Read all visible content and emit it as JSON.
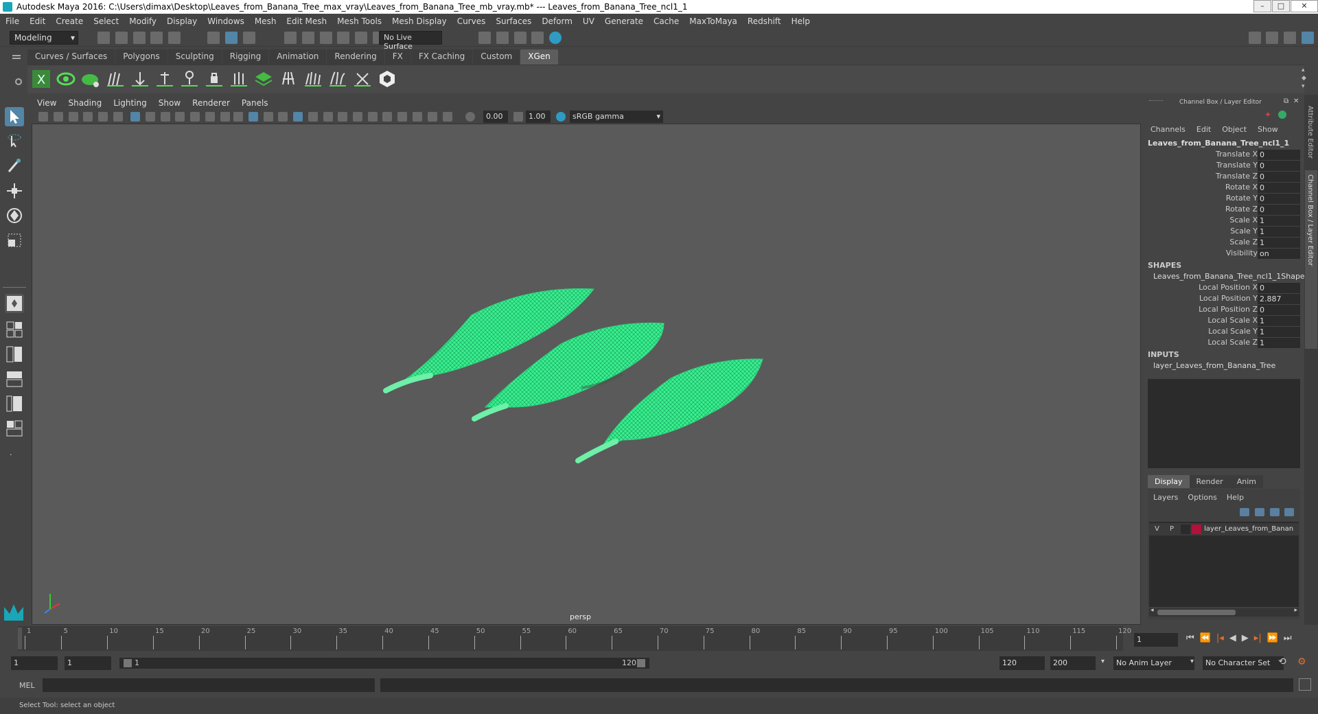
{
  "window": {
    "title": "Autodesk Maya 2016: C:\\Users\\dimax\\Desktop\\Leaves_from_Banana_Tree_max_vray\\Leaves_from_Banana_Tree_mb_vray.mb*   ---   Leaves_from_Banana_Tree_ncl1_1"
  },
  "menubar": [
    "File",
    "Edit",
    "Create",
    "Select",
    "Modify",
    "Display",
    "Windows",
    "Mesh",
    "Edit Mesh",
    "Mesh Tools",
    "Mesh Display",
    "Curves",
    "Surfaces",
    "Deform",
    "UV",
    "Generate",
    "Cache",
    "MaxToMaya",
    "Redshift",
    "Help"
  ],
  "status": {
    "mode": "Modeling",
    "live_surface": "No Live Surface"
  },
  "shelf_tabs": [
    "Curves / Surfaces",
    "Polygons",
    "Sculpting",
    "Rigging",
    "Animation",
    "Rendering",
    "FX",
    "FX Caching",
    "Custom",
    "XGen"
  ],
  "shelf_active": "XGen",
  "viewport": {
    "menu": [
      "View",
      "Shading",
      "Lighting",
      "Show",
      "Renderer",
      "Panels"
    ],
    "exposure": "0.00",
    "gamma": "1.00",
    "color_space": "sRGB gamma",
    "camera_label": "persp"
  },
  "channel_box": {
    "header": "Channel Box / Layer Editor",
    "menu": [
      "Channels",
      "Edit",
      "Object",
      "Show"
    ],
    "object_name": "Leaves_from_Banana_Tree_ncl1_1",
    "attributes": [
      {
        "name": "Translate X",
        "value": "0"
      },
      {
        "name": "Translate Y",
        "value": "0"
      },
      {
        "name": "Translate Z",
        "value": "0"
      },
      {
        "name": "Rotate X",
        "value": "0"
      },
      {
        "name": "Rotate Y",
        "value": "0"
      },
      {
        "name": "Rotate Z",
        "value": "0"
      },
      {
        "name": "Scale X",
        "value": "1"
      },
      {
        "name": "Scale Y",
        "value": "1"
      },
      {
        "name": "Scale Z",
        "value": "1"
      },
      {
        "name": "Visibility",
        "value": "on"
      }
    ],
    "shapes_label": "SHAPES",
    "shape_name": "Leaves_from_Banana_Tree_ncl1_1Shape",
    "shape_attributes": [
      {
        "name": "Local Position X",
        "value": "0"
      },
      {
        "name": "Local Position Y",
        "value": "2.887"
      },
      {
        "name": "Local Position Z",
        "value": "0"
      },
      {
        "name": "Local Scale X",
        "value": "1"
      },
      {
        "name": "Local Scale Y",
        "value": "1"
      },
      {
        "name": "Local Scale Z",
        "value": "1"
      }
    ],
    "inputs_label": "INPUTS",
    "input_name": "layer_Leaves_from_Banana_Tree"
  },
  "layer_editor": {
    "tabs": [
      "Display",
      "Render",
      "Anim"
    ],
    "menu": [
      "Layers",
      "Options",
      "Help"
    ],
    "layer": {
      "v": "V",
      "p": "P",
      "name": "layer_Leaves_from_Banan",
      "color": "#b0123a"
    }
  },
  "side_tabs": {
    "attribute_editor": "Attribute Editor",
    "channel_box": "Channel Box / Layer Editor"
  },
  "timeline": {
    "ticks": [
      "1",
      "5",
      "10",
      "15",
      "20",
      "25",
      "30",
      "35",
      "40",
      "45",
      "50",
      "55",
      "60",
      "65",
      "70",
      "75",
      "80",
      "85",
      "90",
      "95",
      "100",
      "105",
      "110",
      "115",
      "120"
    ],
    "current_frame": "1"
  },
  "range": {
    "start": "1",
    "start2": "1",
    "slider_start": "1",
    "slider_end": "120",
    "end": "120",
    "end2": "200",
    "anim_layer": "No Anim Layer",
    "char_set": "No Character Set"
  },
  "cmd": {
    "label": "MEL"
  },
  "help": {
    "text": "Select Tool: select an object"
  },
  "colors": {
    "leaf": "#39f08f",
    "leaf_dark": "#20b866"
  }
}
